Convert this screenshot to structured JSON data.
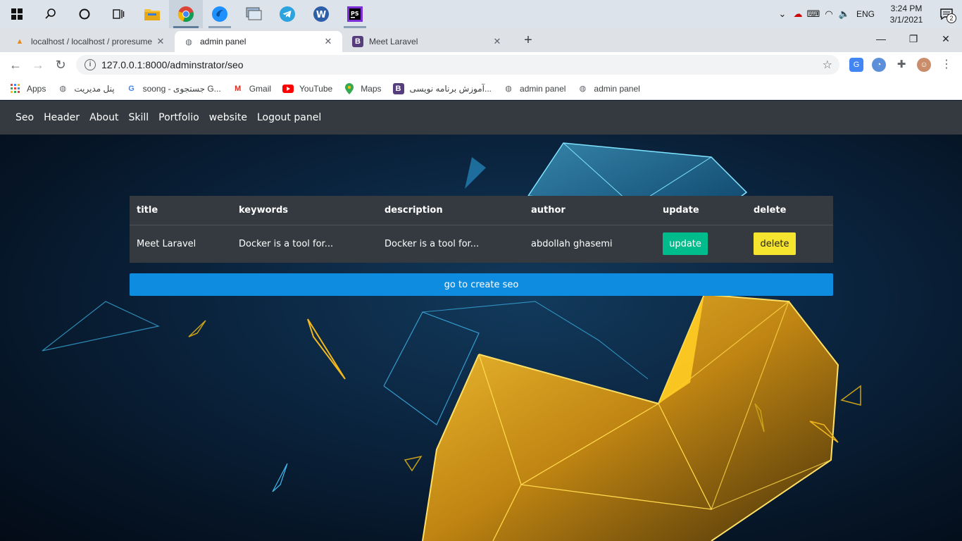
{
  "taskbar": {
    "apps": [
      "start",
      "search",
      "cortana",
      "task-view",
      "file-explorer",
      "chrome",
      "app-blue",
      "app-remote",
      "telegram",
      "wamp",
      "phpstorm"
    ],
    "tray": {
      "language": "ENG",
      "time": "3:24 PM",
      "date": "3/1/2021",
      "notifications": "2"
    }
  },
  "browser": {
    "tabs": [
      {
        "title": "localhost / localhost / proresume",
        "icon": "pma"
      },
      {
        "title": "admin panel",
        "icon": "globe",
        "active": true
      },
      {
        "title": "Meet Laravel",
        "icon": "B"
      }
    ],
    "url": "127.0.0.1:8000/adminstrator/seo",
    "bookmarks": [
      {
        "label": "Apps",
        "icon": "apps-grid"
      },
      {
        "label": "پنل مدیریت",
        "icon": "globe"
      },
      {
        "label": "soong - جستجوی G...",
        "icon": "google"
      },
      {
        "label": "Gmail",
        "icon": "gmail"
      },
      {
        "label": "YouTube",
        "icon": "youtube"
      },
      {
        "label": "Maps",
        "icon": "maps"
      },
      {
        "label": "آموزش برنامه نویسی...",
        "icon": "B"
      },
      {
        "label": "admin panel",
        "icon": "globe"
      },
      {
        "label": "admin panel",
        "icon": "globe"
      }
    ]
  },
  "nav": {
    "links": [
      "Seo",
      "Header",
      "About",
      "Skill",
      "Portfolio",
      "website",
      "Logout panel"
    ]
  },
  "table": {
    "headers": [
      "title",
      "keywords",
      "description",
      "author",
      "update",
      "delete"
    ],
    "rows": [
      {
        "title": "Meet Laravel",
        "keywords": "Docker is a tool for...",
        "description": "Docker is a tool for...",
        "author": "abdollah ghasemi",
        "update_label": "update",
        "delete_label": "delete"
      }
    ]
  },
  "create_button": "go to create seo",
  "colors": {
    "navbar": "#343a40",
    "update": "#00bc8c",
    "delete": "#f5e52e",
    "primary": "#0e8ce0"
  }
}
